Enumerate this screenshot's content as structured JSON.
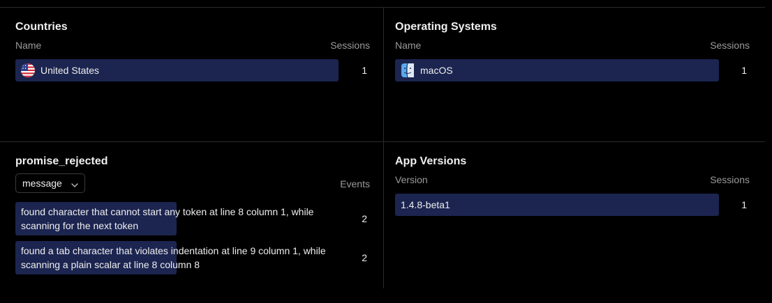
{
  "countries": {
    "title": "Countries",
    "col_name": "Name",
    "col_value": "Sessions",
    "rows": [
      {
        "label": "United States",
        "value": "1",
        "icon": "us-flag-icon"
      }
    ]
  },
  "operating_systems": {
    "title": "Operating Systems",
    "col_name": "Name",
    "col_value": "Sessions",
    "rows": [
      {
        "label": "macOS",
        "value": "1",
        "icon": "macos-finder-icon"
      }
    ]
  },
  "promise_rejected": {
    "title": "promise_rejected",
    "dropdown": {
      "selected": "message",
      "icon": "chevron-down-icon"
    },
    "col_value": "Events",
    "rows": [
      {
        "label": "found character that cannot start any token at line 8 column 1, while scanning for the next token",
        "value": "2"
      },
      {
        "label": "found a tab character that violates indentation at line 9 column 1, while scanning a plain scalar at line 8 column 8",
        "value": "2"
      }
    ]
  },
  "app_versions": {
    "title": "App Versions",
    "col_name": "Version",
    "col_value": "Sessions",
    "rows": [
      {
        "label": "1.4.8-beta1",
        "value": "1"
      }
    ]
  },
  "colors": {
    "background": "#000000",
    "bar": "#1c2550",
    "divider": "#2a2a2a",
    "muted_text": "#9a9a9a"
  }
}
